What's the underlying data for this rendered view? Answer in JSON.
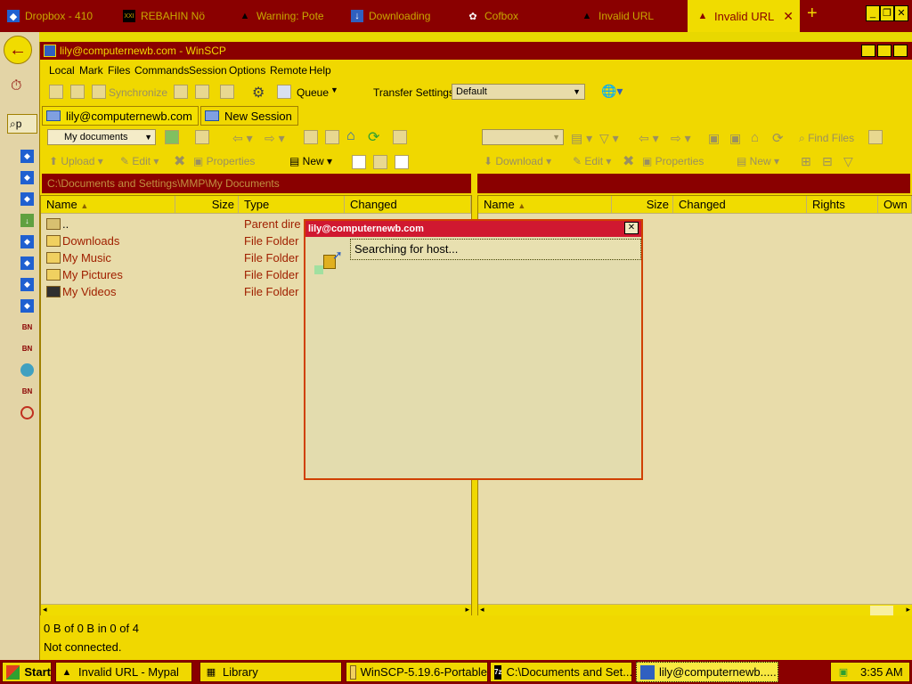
{
  "browser": {
    "tabs": [
      {
        "label": "Dropbox - 410",
        "icon": "dropbox-icon"
      },
      {
        "label": "REBAHIN Nö",
        "icon": "xxi-icon"
      },
      {
        "label": "Warning: Pote",
        "icon": "warning-icon"
      },
      {
        "label": "Downloading",
        "icon": "download-icon"
      },
      {
        "label": "Cofbox",
        "icon": "gear-icon"
      },
      {
        "label": "Invalid URL",
        "icon": "warning-icon"
      },
      {
        "label": "Invalid URL",
        "icon": "warning-icon",
        "active": true
      }
    ],
    "new_tab": "+",
    "window_controls": [
      "_",
      "❐",
      "✕"
    ],
    "search_prefix": "p"
  },
  "winscp": {
    "title": "lily@computernewb.com - WinSCP",
    "menu": [
      "Local",
      "Mark",
      "Files",
      "Commands",
      "Session",
      "Options",
      "Remote",
      "Help"
    ],
    "toolbar": {
      "synchronize": "Synchronize",
      "queue": "Queue",
      "transfer_settings_label": "Transfer Settings",
      "transfer_settings_value": "Default"
    },
    "session_tabs": [
      "lily@computernewb.com",
      "New Session"
    ],
    "local": {
      "location": "My documents",
      "upload": "Upload",
      "edit": "Edit",
      "properties": "Properties",
      "new": "New",
      "path": "C:\\Documents and Settings\\MMP\\My Documents",
      "columns": [
        "Name",
        "Size",
        "Type",
        "Changed"
      ],
      "files": [
        {
          "name": "..",
          "type": "Parent dire"
        },
        {
          "name": "Downloads",
          "type": "File Folder"
        },
        {
          "name": "My Music",
          "type": "File Folder"
        },
        {
          "name": "My Pictures",
          "type": "File Folder"
        },
        {
          "name": "My Videos",
          "type": "File Folder"
        }
      ]
    },
    "remote": {
      "download": "Download",
      "edit": "Edit",
      "properties": "Properties",
      "new": "New",
      "find_files": "Find Files",
      "columns": [
        "Name",
        "Size",
        "Changed",
        "Rights",
        "Own"
      ]
    },
    "dialog": {
      "title": "lily@computernewb.com",
      "message": "Searching for host..."
    },
    "status": {
      "selection": "0 B of 0 B in 0 of 4",
      "connection": "Not connected."
    }
  },
  "taskbar": {
    "start": "Start",
    "items": [
      {
        "label": "Invalid URL - Mypal",
        "icon": "warning-icon"
      },
      {
        "label": "Library",
        "icon": "library-icon"
      },
      {
        "label": "WinSCP-5.19.6-Portable",
        "icon": "folder-icon"
      },
      {
        "label": "C:\\Documents and Set...",
        "icon": "7zip-icon"
      },
      {
        "label": "lily@computernewb.....",
        "icon": "winscp-icon"
      }
    ],
    "clock": "3:35 AM"
  },
  "colors": {
    "accent_dark_red": "#8a0000",
    "window_yellow": "#f0d800",
    "dialog_title_red": "#d01830"
  }
}
